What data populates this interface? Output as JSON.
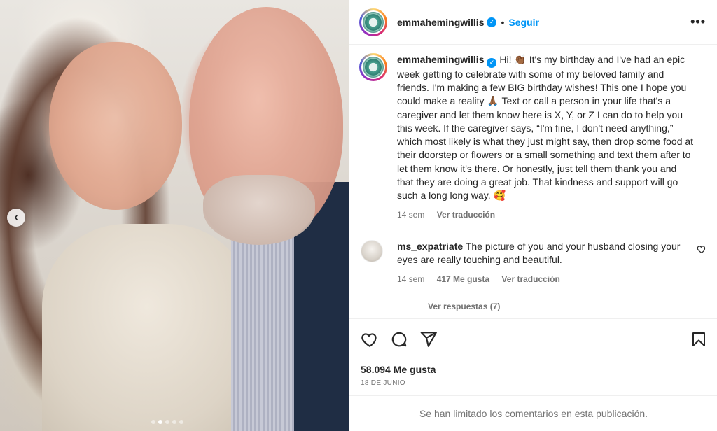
{
  "post": {
    "author": "emmahemingwillis",
    "follow_label": "Seguir",
    "separator": "•",
    "more_label": "•••",
    "prev_label": "‹"
  },
  "caption": {
    "author": "emmahemingwillis",
    "text": "Hi! 👏🏾 It's my birthday and I've had an epic week getting to celebrate with some of my beloved family and friends.  I'm making a few BIG birthday wishes! This one I hope you could make a reality 🙏🏾 Text or call a person in your life that's a caregiver and let them know here is X, Y, or Z I can do to help you this week. If the caregiver says, “I'm fine, I don't need anything,” which most likely is what they just might say, then drop some food at their doorstep or flowers or a small something and text them after to let them know it's there. Or honestly, just tell them thank you and that they are doing a great job. That kindness and support will go such a long long way. 🥰",
    "age": "14 sem",
    "translate": "Ver traducción"
  },
  "comment": {
    "author": "ms_expatriate",
    "text": "The picture of you and your husband closing your eyes are really touching and beautiful.",
    "age": "14 sem",
    "likes": "417 Me gusta",
    "translate": "Ver traducción",
    "replies": "Ver respuestas (7)"
  },
  "stats": {
    "likes": "58.094 Me gusta",
    "date": "18 DE JUNIO"
  },
  "footer": {
    "limited": "Se han limitado los comentarios en esta publicación."
  },
  "carousel": {
    "total": 5,
    "current": 2
  },
  "colors": {
    "accent": "#0095f6",
    "text": "#262626",
    "muted": "#737373"
  }
}
